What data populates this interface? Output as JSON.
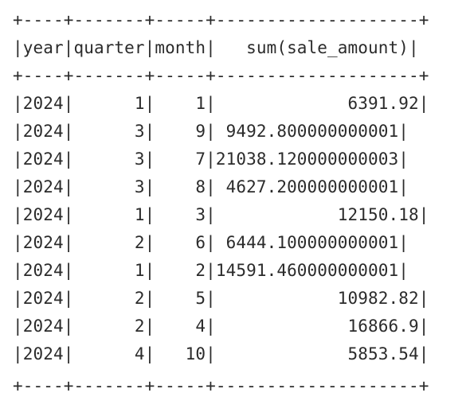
{
  "output": {
    "border_top": "+----+-------+-----+--------------------+",
    "header_row": "|year|quarter|month|   sum(sale_amount)|",
    "border_mid": "+----+-------+-----+--------------------+",
    "rows": [
      "|2024|      1|    1|             6391.92|",
      "|2024|      3|    9| 9492.800000000001|",
      "|2024|      3|    7|21038.120000000003|",
      "|2024|      3|    8| 4627.200000000001|",
      "|2024|      1|    3|            12150.18|",
      "|2024|      2|    6| 6444.100000000001|",
      "|2024|      1|    2|14591.460000000001|",
      "|2024|      2|    5|            10982.82|",
      "|2024|      2|    4|             16866.9|",
      "|2024|      4|   10|             5853.54|"
    ],
    "border_bottom": "+----+-------+-----+--------------------+"
  }
}
